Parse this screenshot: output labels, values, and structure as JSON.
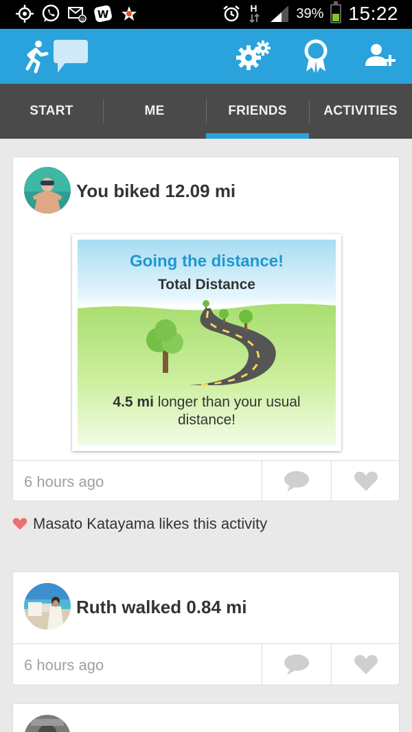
{
  "status_bar": {
    "battery_pct": "39%",
    "time": "15:22",
    "network_label": "H",
    "left_icons": [
      "gps-icon",
      "whatsapp-icon",
      "message-icon",
      "w-app-icon",
      "star-icon"
    ],
    "right_icons": [
      "alarm-icon",
      "network-type-icon",
      "signal-icon",
      "battery-icon"
    ]
  },
  "app_bar": {
    "icons": [
      "runner-icon",
      "chat-bubble-icon",
      "settings-gears-icon",
      "award-ribbon-icon",
      "add-friend-icon"
    ],
    "color": "#2aa3dc"
  },
  "tabs": [
    {
      "label": "START"
    },
    {
      "label": "ME"
    },
    {
      "label": "FRIENDS",
      "active": true
    },
    {
      "label": "ACTIVITIES"
    }
  ],
  "feed": [
    {
      "headline": "You biked 12.09 mi",
      "badge": {
        "title": "Going the distance!",
        "subtitle": "Total Distance",
        "message_bold": "4.5 mi",
        "message_rest": " longer than your usual distance!"
      },
      "time": "6 hours ago"
    },
    {
      "headline": "Ruth walked 0.84 mi",
      "time": "6 hours ago"
    }
  ],
  "likes_text": "Masato Katayama likes this activity",
  "colors": {
    "accent": "#2aa3dc",
    "tab_bar": "#4a4a4a",
    "like_heart": "#ee6f6f",
    "badge_title": "#1f97d4"
  }
}
